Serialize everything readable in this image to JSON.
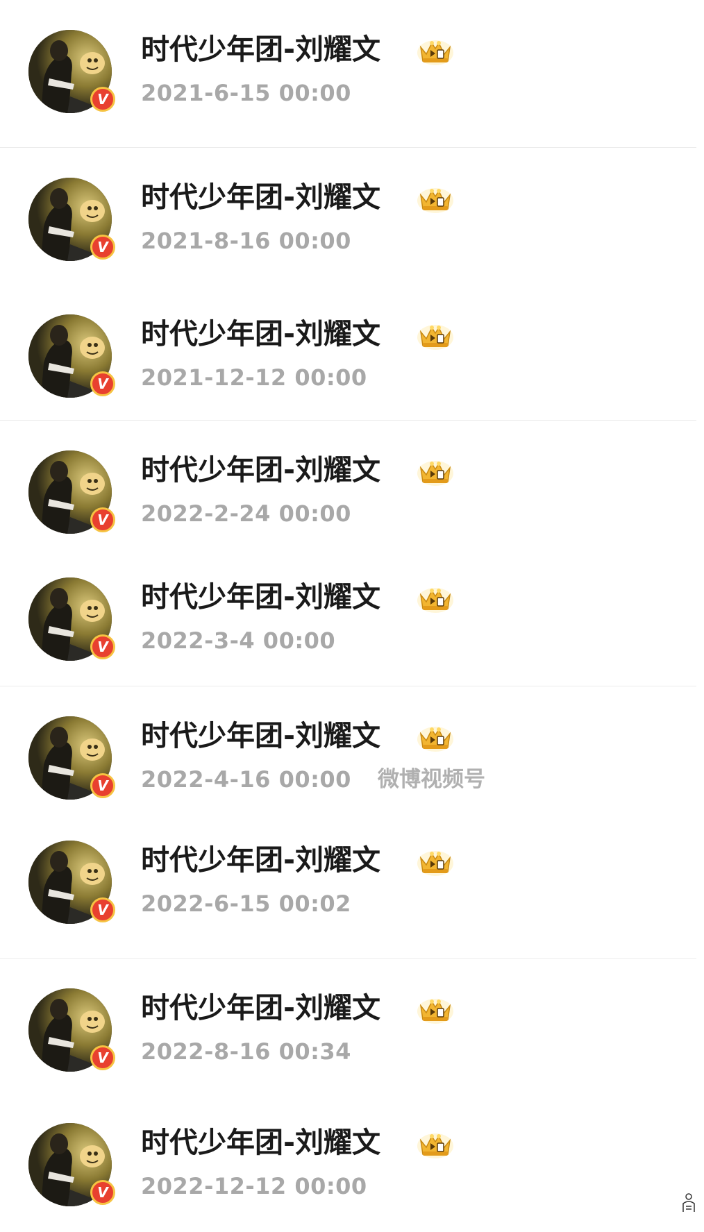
{
  "colors": {
    "name_text": "#1a1a1a",
    "timestamp_text": "#a8a8a8",
    "verified_badge": "#e8402f",
    "badge_ring": "#f6c342",
    "crown_gold": "#f2b531",
    "divider": "#ececec"
  },
  "icons": {
    "avatar": "profile-photo",
    "verified": "verified-v-badge-icon",
    "crown": "vip-crown-icon"
  },
  "verified_badge_text": "V",
  "posts": [
    {
      "username": "时代少年团-刘耀文",
      "timestamp": "2021-6-15 00:00",
      "source": ""
    },
    {
      "username": "时代少年团-刘耀文",
      "timestamp": "2021-8-16 00:00",
      "source": ""
    },
    {
      "username": "时代少年团-刘耀文",
      "timestamp": "2021-12-12 00:00",
      "source": ""
    },
    {
      "username": "时代少年团-刘耀文",
      "timestamp": "2022-2-24 00:00",
      "source": ""
    },
    {
      "username": "时代少年团-刘耀文",
      "timestamp": "2022-3-4 00:00",
      "source": ""
    },
    {
      "username": "时代少年团-刘耀文",
      "timestamp": "2022-4-16 00:00",
      "source": "微博视频号"
    },
    {
      "username": "时代少年团-刘耀文",
      "timestamp": "2022-6-15 00:02",
      "source": ""
    },
    {
      "username": "时代少年团-刘耀文",
      "timestamp": "2022-8-16 00:34",
      "source": ""
    },
    {
      "username": "时代少年团-刘耀文",
      "timestamp": "2022-12-12 00:00",
      "source": ""
    }
  ]
}
